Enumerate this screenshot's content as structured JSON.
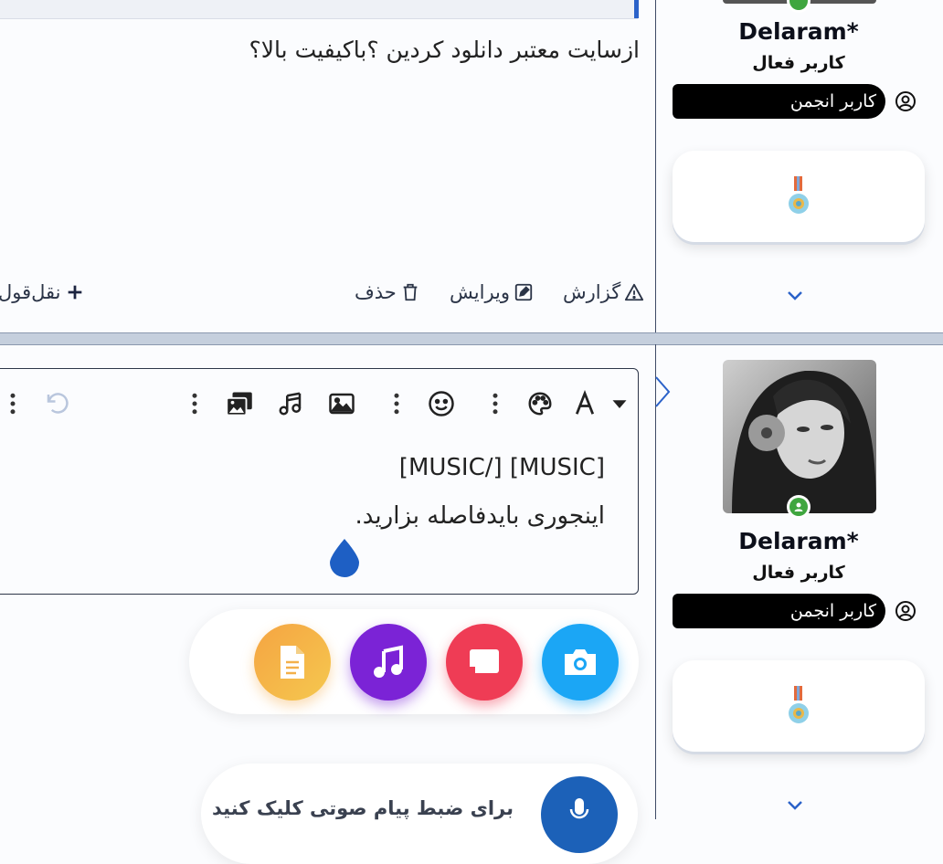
{
  "post1": {
    "text": "ازسایت معتبر دانلود کردین ؟باکیفیت بالا؟",
    "actions": {
      "report": "گزارش",
      "edit": "ویرایش",
      "delete": "حذف",
      "quote": "نقل‌قول"
    }
  },
  "user1": {
    "name": "Delaram*",
    "role": "کاربر فعال",
    "badge": "کاربر انجمن"
  },
  "user2": {
    "name": "Delaram*",
    "role": "کاربر فعال",
    "badge": "کاربر انجمن"
  },
  "editor": {
    "line1": "[MUSIC] [/MUSIC]",
    "line2": "اینجوری بایدفاصله بزارید."
  },
  "attachments": {
    "colors": {
      "camera": "#1ba6f5",
      "screen": "#ef3c55",
      "music": "#7b23d6",
      "file": "#f3b04a"
    }
  },
  "voice": {
    "label": "برای ضبط پیام صوتی کلیک کنید"
  },
  "colors": {
    "accent": "#2b62c9",
    "online": "#3fa63f"
  }
}
